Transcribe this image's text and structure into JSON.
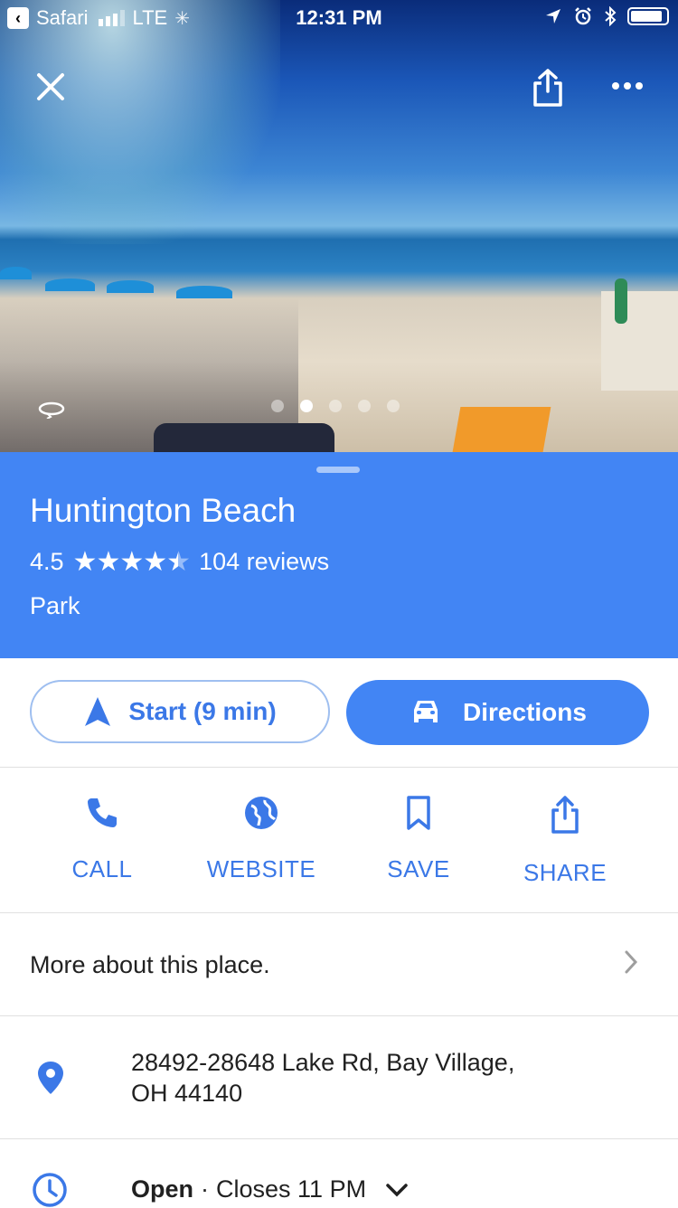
{
  "status_bar": {
    "back_app": "Safari",
    "carrier": "LTE",
    "time": "12:31 PM"
  },
  "photo": {
    "page_count": 5,
    "active_index": 1
  },
  "place": {
    "name": "Huntington Beach",
    "rating": "4.5",
    "rating_value": 4.5,
    "reviews": "104 reviews",
    "category": "Park"
  },
  "buttons": {
    "start_label": "Start (9 min)",
    "directions_label": "Directions"
  },
  "actions": [
    {
      "label": "CALL",
      "icon": "phone-icon"
    },
    {
      "label": "WEBSITE",
      "icon": "globe-icon"
    },
    {
      "label": "SAVE",
      "icon": "bookmark-icon"
    },
    {
      "label": "SHARE",
      "icon": "share-icon"
    }
  ],
  "more": {
    "label": "More about this place."
  },
  "address": {
    "line1": "28492-28648 Lake Rd, Bay Village,",
    "line2": "OH 44140"
  },
  "hours": {
    "status": "Open",
    "separator": "·",
    "closes": "Closes 11 PM"
  },
  "colors": {
    "accent": "#4285f4",
    "accent_text": "#3b78e7"
  }
}
